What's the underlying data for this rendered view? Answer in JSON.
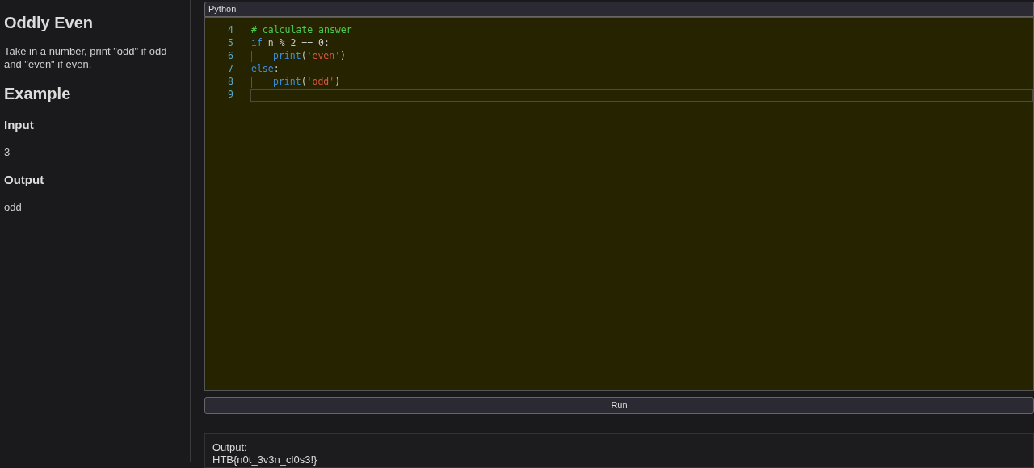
{
  "problem": {
    "title": "Oddly Even",
    "description": "Take in a number, print \"odd\" if odd and \"even\" if even.",
    "example_heading": "Example",
    "input_heading": "Input",
    "input_value": "3",
    "output_heading": "Output",
    "output_value": "odd"
  },
  "editor": {
    "language": "Python",
    "lines": [
      {
        "number": "4",
        "indented": false,
        "active": false,
        "tokens": [
          {
            "kind": "comment",
            "text": "# calculate answer"
          }
        ]
      },
      {
        "number": "5",
        "indented": false,
        "active": false,
        "tokens": [
          {
            "kind": "keyword",
            "text": "if"
          },
          {
            "kind": "plain",
            "text": " n % 2 == 0:"
          }
        ]
      },
      {
        "number": "6",
        "indented": true,
        "active": false,
        "tokens": [
          {
            "kind": "keyword",
            "text": "print"
          },
          {
            "kind": "plain",
            "text": "("
          },
          {
            "kind": "string",
            "text": "'even'"
          },
          {
            "kind": "plain",
            "text": ")"
          }
        ]
      },
      {
        "number": "7",
        "indented": false,
        "active": false,
        "tokens": [
          {
            "kind": "keyword",
            "text": "else"
          },
          {
            "kind": "plain",
            "text": ":"
          }
        ]
      },
      {
        "number": "8",
        "indented": true,
        "active": false,
        "tokens": [
          {
            "kind": "keyword",
            "text": "print"
          },
          {
            "kind": "plain",
            "text": "("
          },
          {
            "kind": "string",
            "text": "'odd'"
          },
          {
            "kind": "plain",
            "text": ")"
          }
        ]
      },
      {
        "number": "9",
        "indented": false,
        "active": true
      }
    ]
  },
  "run_button": "Run",
  "output": {
    "label": "Output:",
    "value": "HTB{n0t_3v3n_cl0s3!}"
  }
}
